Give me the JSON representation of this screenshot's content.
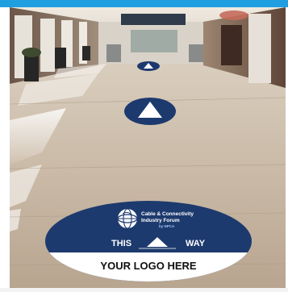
{
  "decal": {
    "brand_line1": "Cable & Connectivity",
    "brand_line2": "Industry Forum",
    "brand_by": "by NPCA",
    "left_word": "THIS",
    "right_word": "WAY",
    "logo_text": "YOUR LOGO HERE"
  },
  "icons": {
    "globe": "globe-icon",
    "arrow": "up-arrow-icon"
  },
  "colors": {
    "navy": "#1d3a6e",
    "accent_blue": "#1f9fe0",
    "white": "#ffffff"
  }
}
